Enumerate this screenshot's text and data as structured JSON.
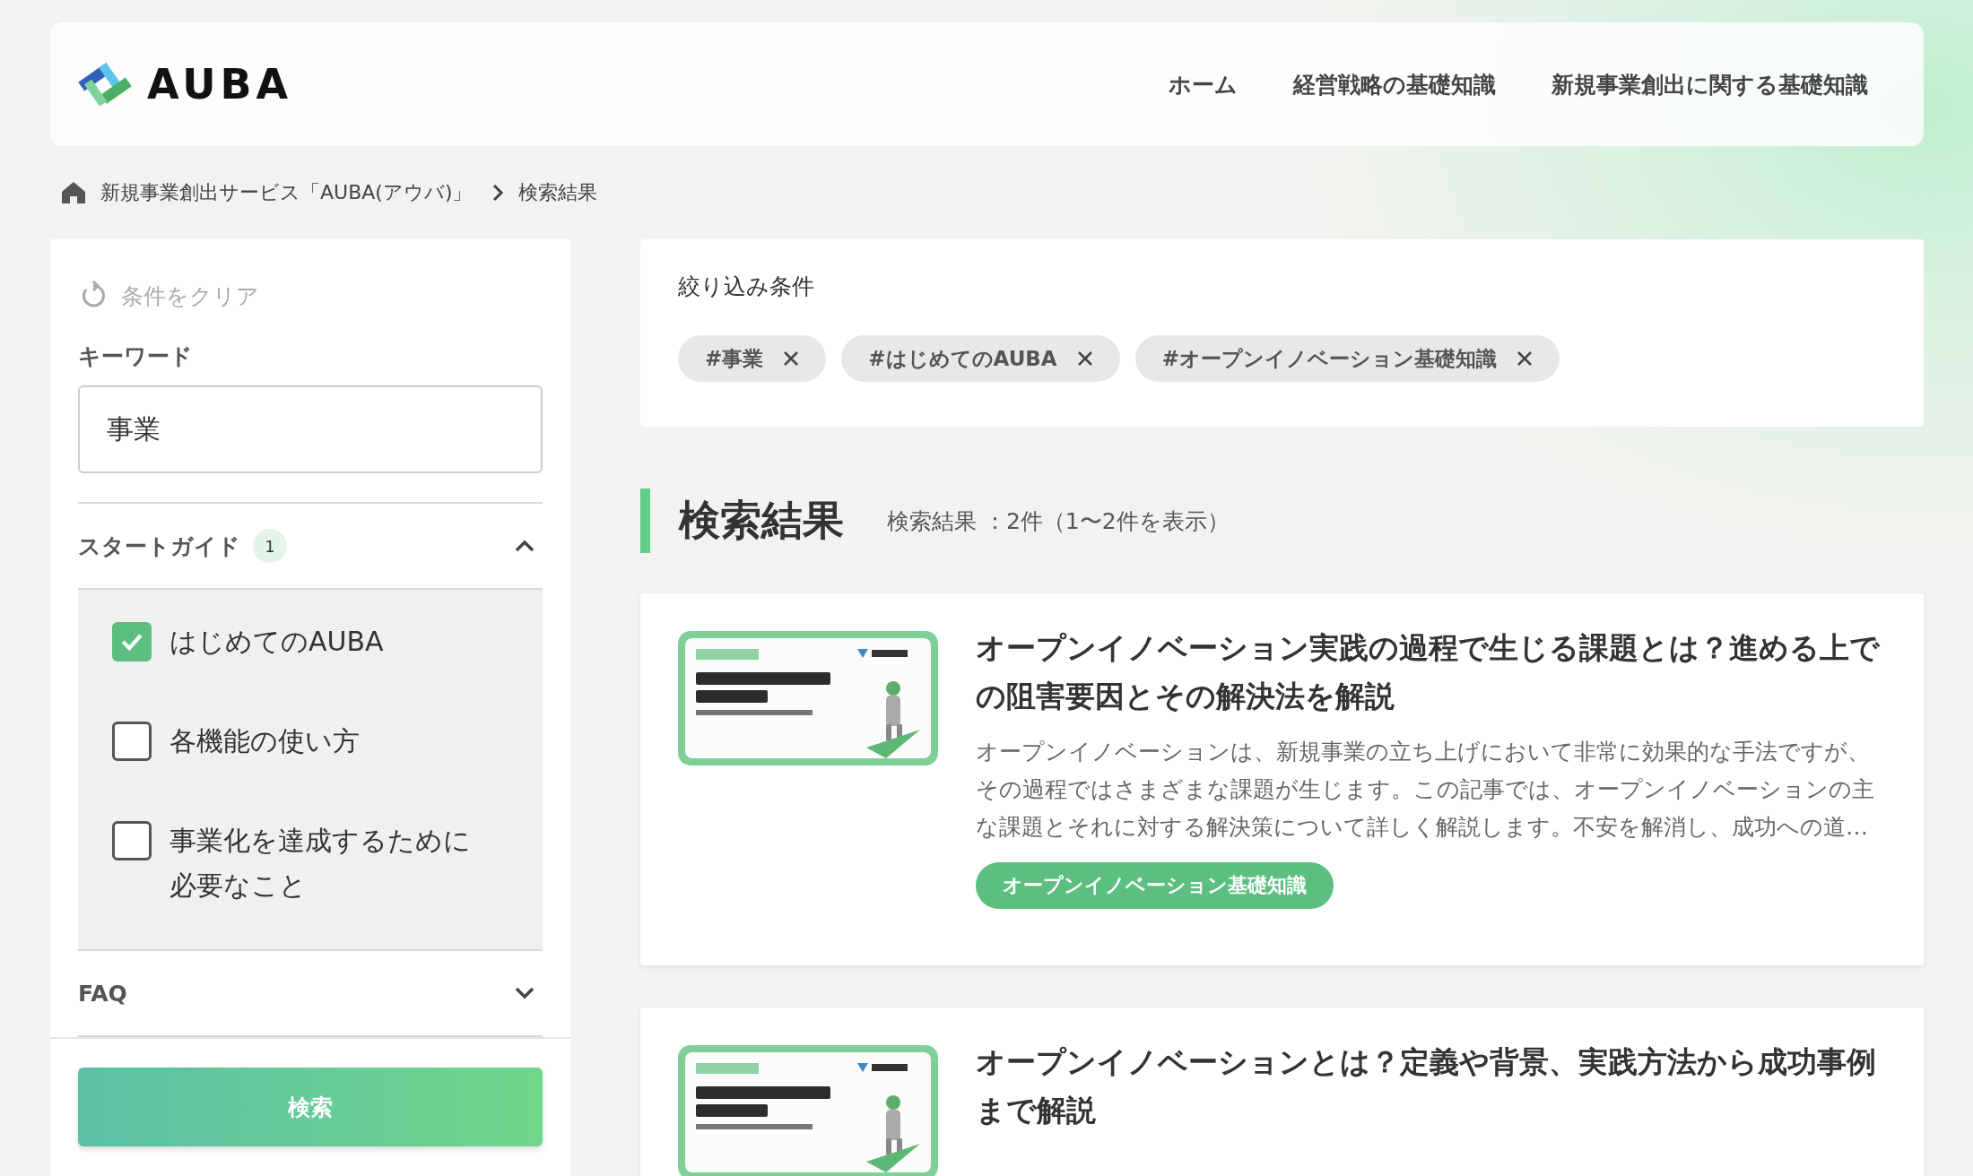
{
  "header": {
    "logo_text": "AUBA",
    "nav": [
      "ホーム",
      "経営戦略の基礎知識",
      "新規事業創出に関する基礎知識"
    ]
  },
  "breadcrumb": [
    "新規事業創出サービス「AUBA(アウバ)」",
    "検索結果"
  ],
  "sidebar": {
    "clear_label": "条件をクリア",
    "keyword_label": "キーワード",
    "keyword_value": "事業",
    "sections": [
      {
        "title": "スタートガイド",
        "count": "1",
        "expanded": true,
        "options": [
          {
            "label": "はじめてのAUBA",
            "checked": true
          },
          {
            "label": "各機能の使い方",
            "checked": false
          },
          {
            "label": "事業化を達成するために必要なこと",
            "checked": false
          }
        ]
      },
      {
        "title": "FAQ",
        "expanded": false
      }
    ],
    "search_button": "検索"
  },
  "filters": {
    "title": "絞り込み条件",
    "tags": [
      "#事業",
      "#はじめてのAUBA",
      "#オープンイノベーション基礎知識"
    ]
  },
  "results": {
    "title": "検索結果",
    "summary": "検索結果 ：2件（1〜2件を表示）",
    "articles": [
      {
        "title": "オープンイノベーション実践の過程で生じる課題とは？進める上での阻害要因とその解決法を解説",
        "description": "オープンイノベーションは、新規事業の立ち上げにおいて非常に効果的な手法ですが、その過程ではさまざまな課題が生じます。この記事では、オープンイノベーションの主な課題とそれに対する解決策について詳しく解説します。不安を解消し、成功への道…",
        "tag": "オープンイノベーション基礎知識"
      },
      {
        "title": "オープンイノベーションとは？定義や背景、実践方法から成功事例まで解説"
      }
    ]
  }
}
